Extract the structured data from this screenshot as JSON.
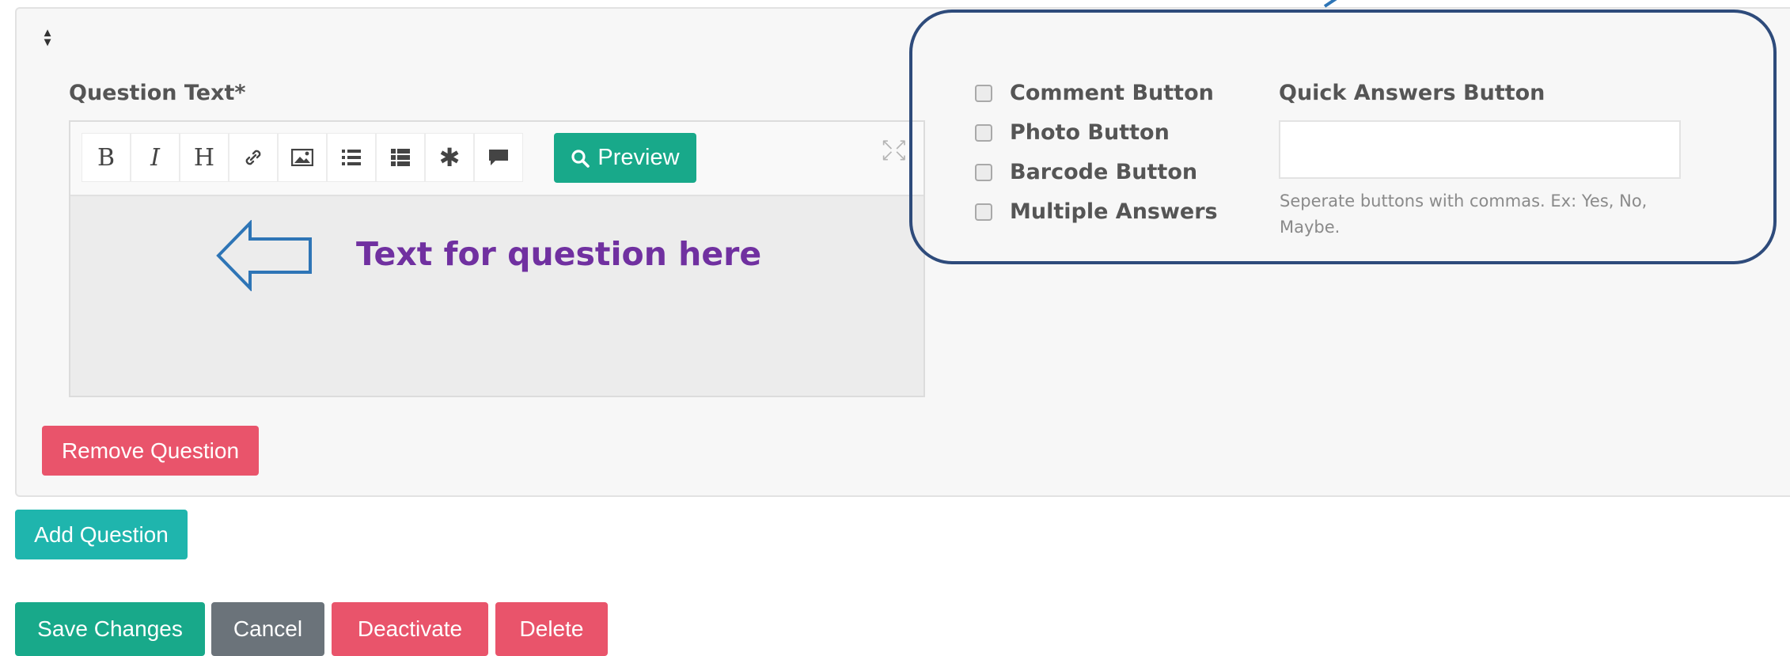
{
  "question": {
    "label": "Question Text*",
    "toolbar": {
      "buttons": [
        {
          "name": "bold-icon",
          "glyph": "B"
        },
        {
          "name": "italic-icon",
          "glyph": "I"
        },
        {
          "name": "heading-icon",
          "glyph": "H"
        },
        {
          "name": "link-icon",
          "glyph": "link"
        },
        {
          "name": "image-icon",
          "glyph": "image"
        },
        {
          "name": "bulleted-list-icon",
          "glyph": "list"
        },
        {
          "name": "numbered-list-icon",
          "glyph": "list-alt"
        },
        {
          "name": "asterisk-icon",
          "glyph": "asterisk"
        },
        {
          "name": "comment-icon",
          "glyph": "comment"
        }
      ],
      "preview_label": "Preview"
    },
    "annotation_text": "Text for question here",
    "remove_label": "Remove Question"
  },
  "options": {
    "checkboxes": [
      {
        "label": "Comment Button",
        "checked": false
      },
      {
        "label": "Photo Button",
        "checked": false
      },
      {
        "label": "Barcode Button",
        "checked": false
      },
      {
        "label": "Multiple Answers",
        "checked": false
      }
    ],
    "quick_answers": {
      "label": "Quick Answers Button",
      "value": "",
      "help": "Seperate buttons with commas. Ex: Yes, No, Maybe."
    }
  },
  "actions": {
    "add_question": "Add Question",
    "save": "Save Changes",
    "cancel": "Cancel",
    "deactivate": "Deactivate",
    "delete": "Delete"
  },
  "colors": {
    "success": "#18a98a",
    "danger": "#e9546b",
    "info": "#1fb5ad",
    "secondary": "#6b737a",
    "callout_border": "#2e4b7b",
    "annotation_text": "#7030a0",
    "annotation_arrow": "#2e75b6"
  }
}
